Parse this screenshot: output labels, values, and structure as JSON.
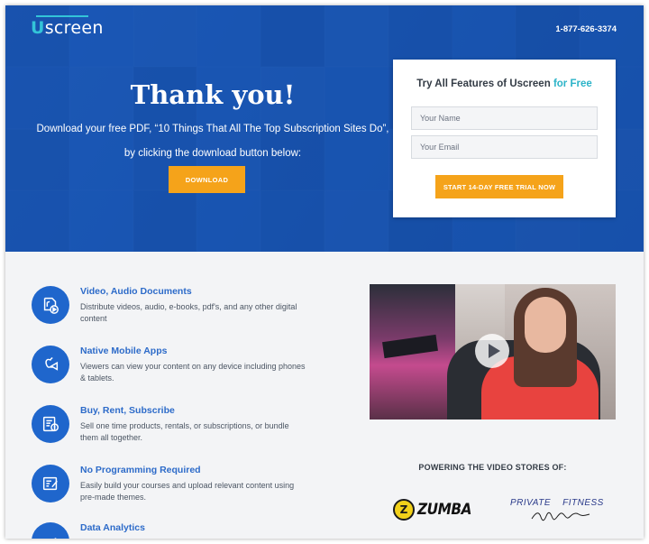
{
  "header": {
    "logo": {
      "first": "U",
      "rest": "screen"
    },
    "phone": "1-877-626-3374"
  },
  "hero": {
    "title": "Thank you!",
    "subtitle": "Download your free PDF, “10 Things That All The Top Subscription Sites Do”, by clicking the download button below:",
    "download_label": "DOWNLOAD"
  },
  "signup_card": {
    "title_main": "Try All Features of Uscreen",
    "title_accent": "for Free",
    "name_placeholder": "Your Name",
    "email_placeholder": "Your Email",
    "cta_label": "START 14-DAY FREE TRIAL NOW"
  },
  "features": [
    {
      "icon": "media-files-icon",
      "title": "Video, Audio Documents",
      "desc": "Distribute videos, audio, e-books, pdf's, and any other digital content"
    },
    {
      "icon": "mobile-apps-icon",
      "title": "Native Mobile Apps",
      "desc": "Viewers can view your content on any device including phones & tablets."
    },
    {
      "icon": "invoice-dollar-icon",
      "title": "Buy, Rent, Subscribe",
      "desc": "Sell one time products, rentals, or subscriptions, or bundle them all together."
    },
    {
      "icon": "edit-document-icon",
      "title": "No Programming Required",
      "desc": "Easily build your courses and upload relevant content using pre-made themes."
    },
    {
      "icon": "bar-chart-icon",
      "title": "Data Analytics",
      "desc": ""
    }
  ],
  "video": {
    "icon": "play-icon"
  },
  "powering": {
    "heading": "POWERING THE VIDEO STORES OF:",
    "logos": [
      {
        "name": "ZUMBA",
        "mark": "Z"
      },
      {
        "name": "PRIVATE    FITNESS"
      }
    ]
  },
  "colors": {
    "brand_blue": "#1f66cc",
    "hero_blue": "#1a56ad",
    "accent_teal": "#2bb3c8",
    "cta_orange": "#f5a31a"
  }
}
